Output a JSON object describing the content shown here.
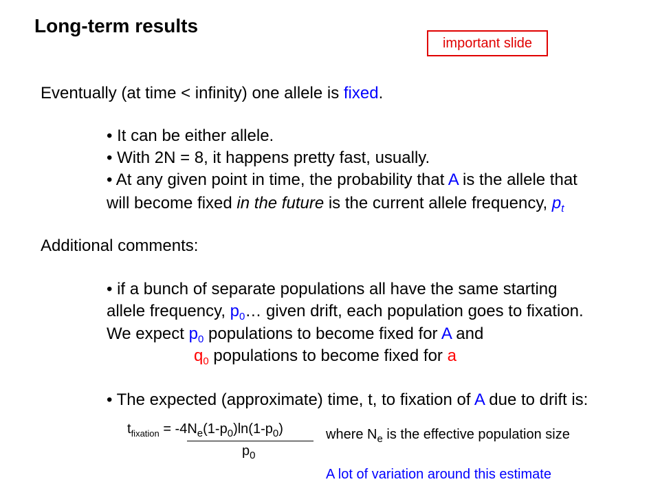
{
  "title": "Long-term results",
  "badge": "important slide",
  "para1": {
    "pre": "Eventually (at time < infinity) one allele is ",
    "fixed": "fixed",
    "post": "."
  },
  "b1": "• It can be either allele.",
  "b2": "• With 2N = 8, it happens pretty fast, usually.",
  "b3": {
    "pre": "• At any given point in time, the probability that ",
    "A": "A",
    "post": " is the allele that",
    "line2_pre": "will become fixed ",
    "italic": "in the future",
    "line2_post": " is the current allele frequency, ",
    "p": "p",
    "sub": "t"
  },
  "additional": "Additional comments:",
  "b4": {
    "l1": "• if a bunch of separate populations all have the same starting",
    "l2_pre": "allele frequency, ",
    "p": "p",
    "sub0": "0",
    "l2_post": "… given drift, each population goes to fixation.",
    "l3_pre": "We expect ",
    "l3_mid": " populations to become fixed for ",
    "A": "A",
    "l3_post": " and",
    "q": "q",
    "l4_mid": " populations to become fixed for ",
    "a": "a"
  },
  "b5": {
    "pre": "• The expected (approximate) time, t, to fixation of ",
    "A": "A",
    "post": " due to drift is:"
  },
  "formula": {
    "t": "t",
    "t_sub": "fixation",
    "eq": " = -4N",
    "e": "e",
    "mid1": "(1-p",
    "zero": "0",
    "mid2": ")ln(1-p",
    "mid3": ")",
    "den_p": "p",
    "den_sub": "0"
  },
  "where": {
    "pre": "where N",
    "sub": "e",
    "post": " is the effective population size"
  },
  "variation": "A lot of variation around this estimate"
}
